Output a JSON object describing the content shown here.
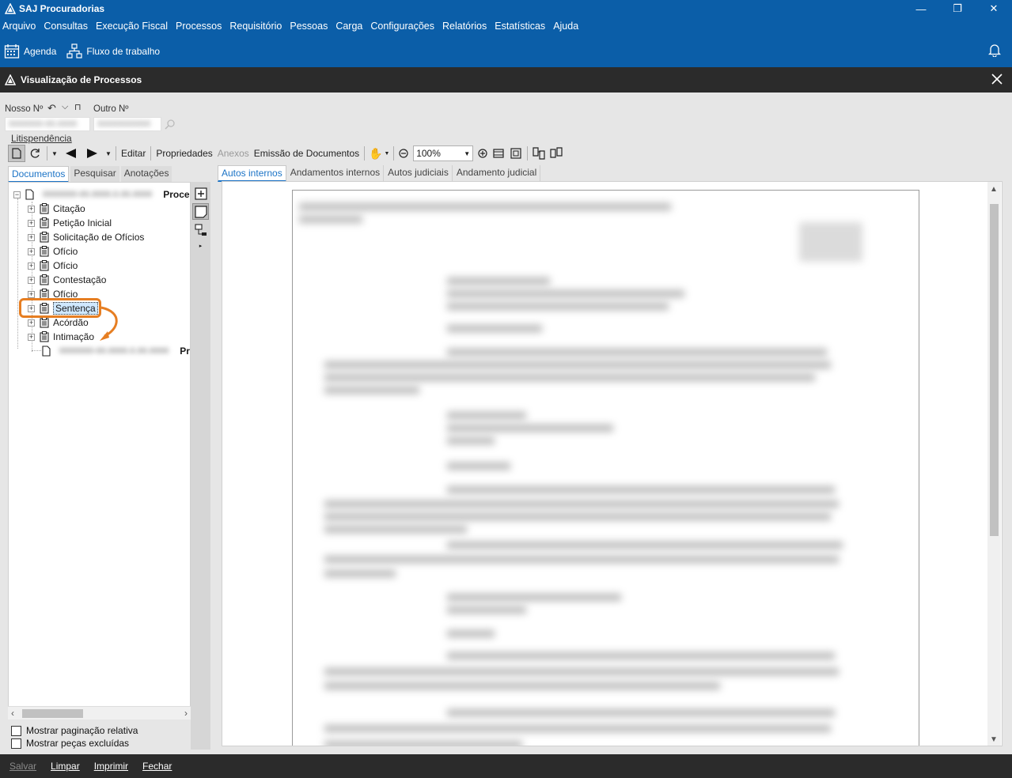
{
  "app": {
    "title": "SAJ Procuradorias"
  },
  "window_controls": {
    "minimize": "—",
    "maximize": "❐",
    "close": "✕"
  },
  "menu": [
    "Arquivo",
    "Consultas",
    "Execução Fiscal",
    "Processos",
    "Requisitório",
    "Pessoas",
    "Carga",
    "Configurações",
    "Relatórios",
    "Estatísticas",
    "Ajuda"
  ],
  "toolbar": {
    "agenda": "Agenda",
    "fluxo": "Fluxo de trabalho"
  },
  "inner": {
    "title": "Visualização de Processos"
  },
  "form": {
    "nosso_label": "Nosso Nº",
    "outro_label": "Outro Nº",
    "nosso_value": "0000000-00.0000",
    "outro_value": "00000000000"
  },
  "litispendencia": "Litispendência",
  "doc_toolbar": {
    "editar": "Editar",
    "propriedades": "Propriedades",
    "anexos": "Anexos",
    "emissao": "Emissão de Documentos",
    "zoom": "100%"
  },
  "left_tabs": [
    "Documentos",
    "Pesquisar",
    "Anotações"
  ],
  "tree": {
    "root_number": "0000000-00.0000.0.00.0000",
    "root_suffix": "Process",
    "items": [
      "Citação",
      "Petição Inicial",
      "Solicitação de Ofícios",
      "Ofício",
      "Ofício",
      "Contestação",
      "Ofício",
      "Sentença",
      "Acórdão",
      "Intimação"
    ],
    "last_number": "0000000-00.0000.0.00.0000",
    "last_suffix": "Pro"
  },
  "checkboxes": {
    "paginacao": "Mostrar paginação relativa",
    "pecas": "Mostrar peças excluídas"
  },
  "right_tabs": [
    "Autos internos",
    "Andamentos internos",
    "Autos judiciais",
    "Andamento judicial"
  ],
  "footer": {
    "salvar": "Salvar",
    "limpar": "Limpar",
    "imprimir": "Imprimir",
    "fechar": "Fechar"
  },
  "colors": {
    "brand": "#0b5ea8",
    "dark_bar": "#2b2b2b",
    "accent": "#1b73c6",
    "annotation": "#e67e22"
  }
}
